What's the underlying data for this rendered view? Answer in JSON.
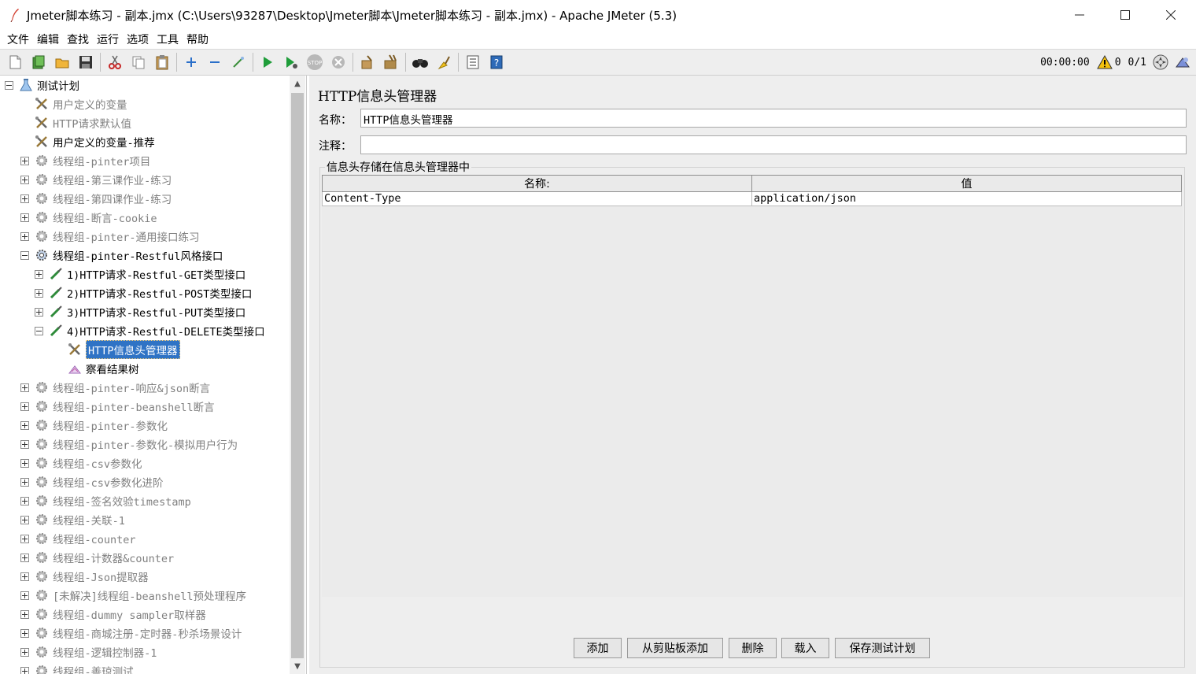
{
  "window": {
    "title": "Jmeter脚本练习 - 副本.jmx (C:\\Users\\93287\\Desktop\\Jmeter脚本\\Jmeter脚本练习 - 副本.jmx) - Apache JMeter (5.3)",
    "minimize": "—",
    "maximize": "☐",
    "close": "✕"
  },
  "menu": [
    "文件",
    "编辑",
    "查找",
    "运行",
    "选项",
    "工具",
    "帮助"
  ],
  "status": {
    "elapsed": "00:00:00",
    "warnings": "0",
    "threads": "0/1"
  },
  "tree": {
    "items": [
      {
        "label": "测试计划",
        "level": 0,
        "icon": "test-plan-icon",
        "exp": "minus",
        "disabled": false
      },
      {
        "label": "用户定义的变量",
        "level": 1,
        "icon": "config-tools-icon",
        "exp": "",
        "disabled": true
      },
      {
        "label": "HTTP请求默认值",
        "level": 1,
        "icon": "config-tools-icon",
        "exp": "",
        "disabled": true
      },
      {
        "label": "用户定义的变量-推荐",
        "level": 1,
        "icon": "config-tools-icon",
        "exp": "",
        "disabled": false
      },
      {
        "label": "线程组-pinter项目",
        "level": 1,
        "icon": "thread-group-icon",
        "exp": "plus",
        "disabled": true
      },
      {
        "label": "线程组-第三课作业-练习",
        "level": 1,
        "icon": "thread-group-icon",
        "exp": "plus",
        "disabled": true
      },
      {
        "label": "线程组-第四课作业-练习",
        "level": 1,
        "icon": "thread-group-icon",
        "exp": "plus",
        "disabled": true
      },
      {
        "label": "线程组-断言-cookie",
        "level": 1,
        "icon": "thread-group-icon",
        "exp": "plus",
        "disabled": true
      },
      {
        "label": "线程组-pinter-通用接口练习",
        "level": 1,
        "icon": "thread-group-icon",
        "exp": "plus",
        "disabled": true
      },
      {
        "label": "线程组-pinter-Restful风格接口",
        "level": 1,
        "icon": "thread-group-active-icon",
        "exp": "minus",
        "disabled": false
      },
      {
        "label": "1)HTTP请求-Restful-GET类型接口",
        "level": 2,
        "icon": "sampler-pipette-icon",
        "exp": "plus",
        "disabled": false
      },
      {
        "label": "2)HTTP请求-Restful-POST类型接口",
        "level": 2,
        "icon": "sampler-pipette-icon",
        "exp": "plus",
        "disabled": false
      },
      {
        "label": "3)HTTP请求-Restful-PUT类型接口",
        "level": 2,
        "icon": "sampler-pipette-icon",
        "exp": "plus",
        "disabled": false
      },
      {
        "label": "4)HTTP请求-Restful-DELETE类型接口",
        "level": 2,
        "icon": "sampler-pipette-icon",
        "exp": "minus",
        "disabled": false
      },
      {
        "label": "HTTP信息头管理器",
        "level": 3,
        "icon": "config-tools-icon",
        "exp": "",
        "disabled": false,
        "selected": true
      },
      {
        "label": "察看结果树",
        "level": 3,
        "icon": "result-tree-icon",
        "exp": "",
        "disabled": false
      },
      {
        "label": "线程组-pinter-响应&json断言",
        "level": 1,
        "icon": "thread-group-icon",
        "exp": "plus",
        "disabled": true
      },
      {
        "label": "线程组-pinter-beanshell断言",
        "level": 1,
        "icon": "thread-group-icon",
        "exp": "plus",
        "disabled": true
      },
      {
        "label": "线程组-pinter-参数化",
        "level": 1,
        "icon": "thread-group-icon",
        "exp": "plus",
        "disabled": true
      },
      {
        "label": "线程组-pinter-参数化-模拟用户行为",
        "level": 1,
        "icon": "thread-group-icon",
        "exp": "plus",
        "disabled": true
      },
      {
        "label": "线程组-csv参数化",
        "level": 1,
        "icon": "thread-group-icon",
        "exp": "plus",
        "disabled": true
      },
      {
        "label": "线程组-csv参数化进阶",
        "level": 1,
        "icon": "thread-group-icon",
        "exp": "plus",
        "disabled": true
      },
      {
        "label": "线程组-签名效验timestamp",
        "level": 1,
        "icon": "thread-group-icon",
        "exp": "plus",
        "disabled": true
      },
      {
        "label": "线程组-关联-1",
        "level": 1,
        "icon": "thread-group-icon",
        "exp": "plus",
        "disabled": true
      },
      {
        "label": "线程组-counter",
        "level": 1,
        "icon": "thread-group-icon",
        "exp": "plus",
        "disabled": true
      },
      {
        "label": "线程组-计数器&counter",
        "level": 1,
        "icon": "thread-group-icon",
        "exp": "plus",
        "disabled": true
      },
      {
        "label": "线程组-Json提取器",
        "level": 1,
        "icon": "thread-group-icon",
        "exp": "plus",
        "disabled": true
      },
      {
        "label": "[未解决]线程组-beanshell预处理程序",
        "level": 1,
        "icon": "thread-group-icon",
        "exp": "plus",
        "disabled": true
      },
      {
        "label": "线程组-dummy sampler取样器",
        "level": 1,
        "icon": "thread-group-icon",
        "exp": "plus",
        "disabled": true
      },
      {
        "label": "线程组-商城注册-定时器-秒杀场景设计",
        "level": 1,
        "icon": "thread-group-icon",
        "exp": "plus",
        "disabled": true
      },
      {
        "label": "线程组-逻辑控制器-1",
        "level": 1,
        "icon": "thread-group-icon",
        "exp": "plus",
        "disabled": true
      },
      {
        "label": "线程组-善琼测试",
        "level": 1,
        "icon": "thread-group-icon",
        "exp": "plus",
        "disabled": true
      }
    ]
  },
  "panel": {
    "title": "HTTP信息头管理器",
    "name_label": "名称：",
    "name_value": "HTTP信息头管理器",
    "comment_label": "注释：",
    "comment_value": "",
    "group_title": "信息头存储在信息头管理器中",
    "table": {
      "headers": [
        "名称:",
        "值"
      ],
      "rows": [
        [
          "Content-Type",
          "application/json"
        ]
      ]
    },
    "buttons": {
      "add": "添加",
      "add_from_clipboard": "从剪贴板添加",
      "delete": "删除",
      "load": "载入",
      "save_plan": "保存测试计划"
    }
  }
}
